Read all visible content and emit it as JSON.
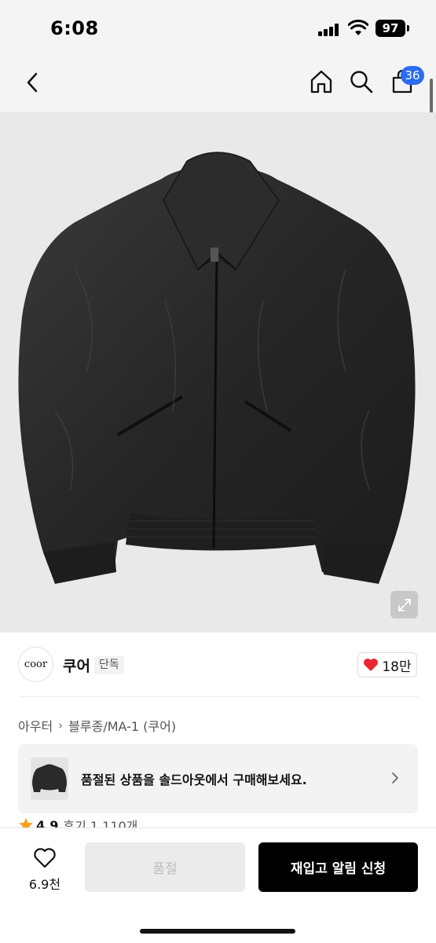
{
  "status_bar": {
    "time": "6:08",
    "battery": "97"
  },
  "nav": {
    "cart_count": "36",
    "icons": [
      "chevron-left-icon",
      "home-icon",
      "search-icon",
      "cart-icon"
    ]
  },
  "product": {
    "image_alt": "black bomber jacket"
  },
  "brand": {
    "logo_text": "coor",
    "name": "쿠어",
    "tag": "단독",
    "likes": "18만",
    "accent": "#e8262f"
  },
  "breadcrumb": {
    "items": [
      "아우터",
      "블루종/MA-1 (쿠어)"
    ]
  },
  "banner": {
    "text": "품절된 상품을 솔드아웃에서 구매해보세요."
  },
  "rating": {
    "score": "4.9",
    "reviews": "후기 1,110개"
  },
  "bottom_bar": {
    "wish_count": "6.9천",
    "soldout_label": "품절",
    "restock_label": "재입고 알림 신청"
  },
  "colors": {
    "badge": "#2a6bf0",
    "primary_button": "#000000",
    "disabled_button": "#ebebeb"
  }
}
